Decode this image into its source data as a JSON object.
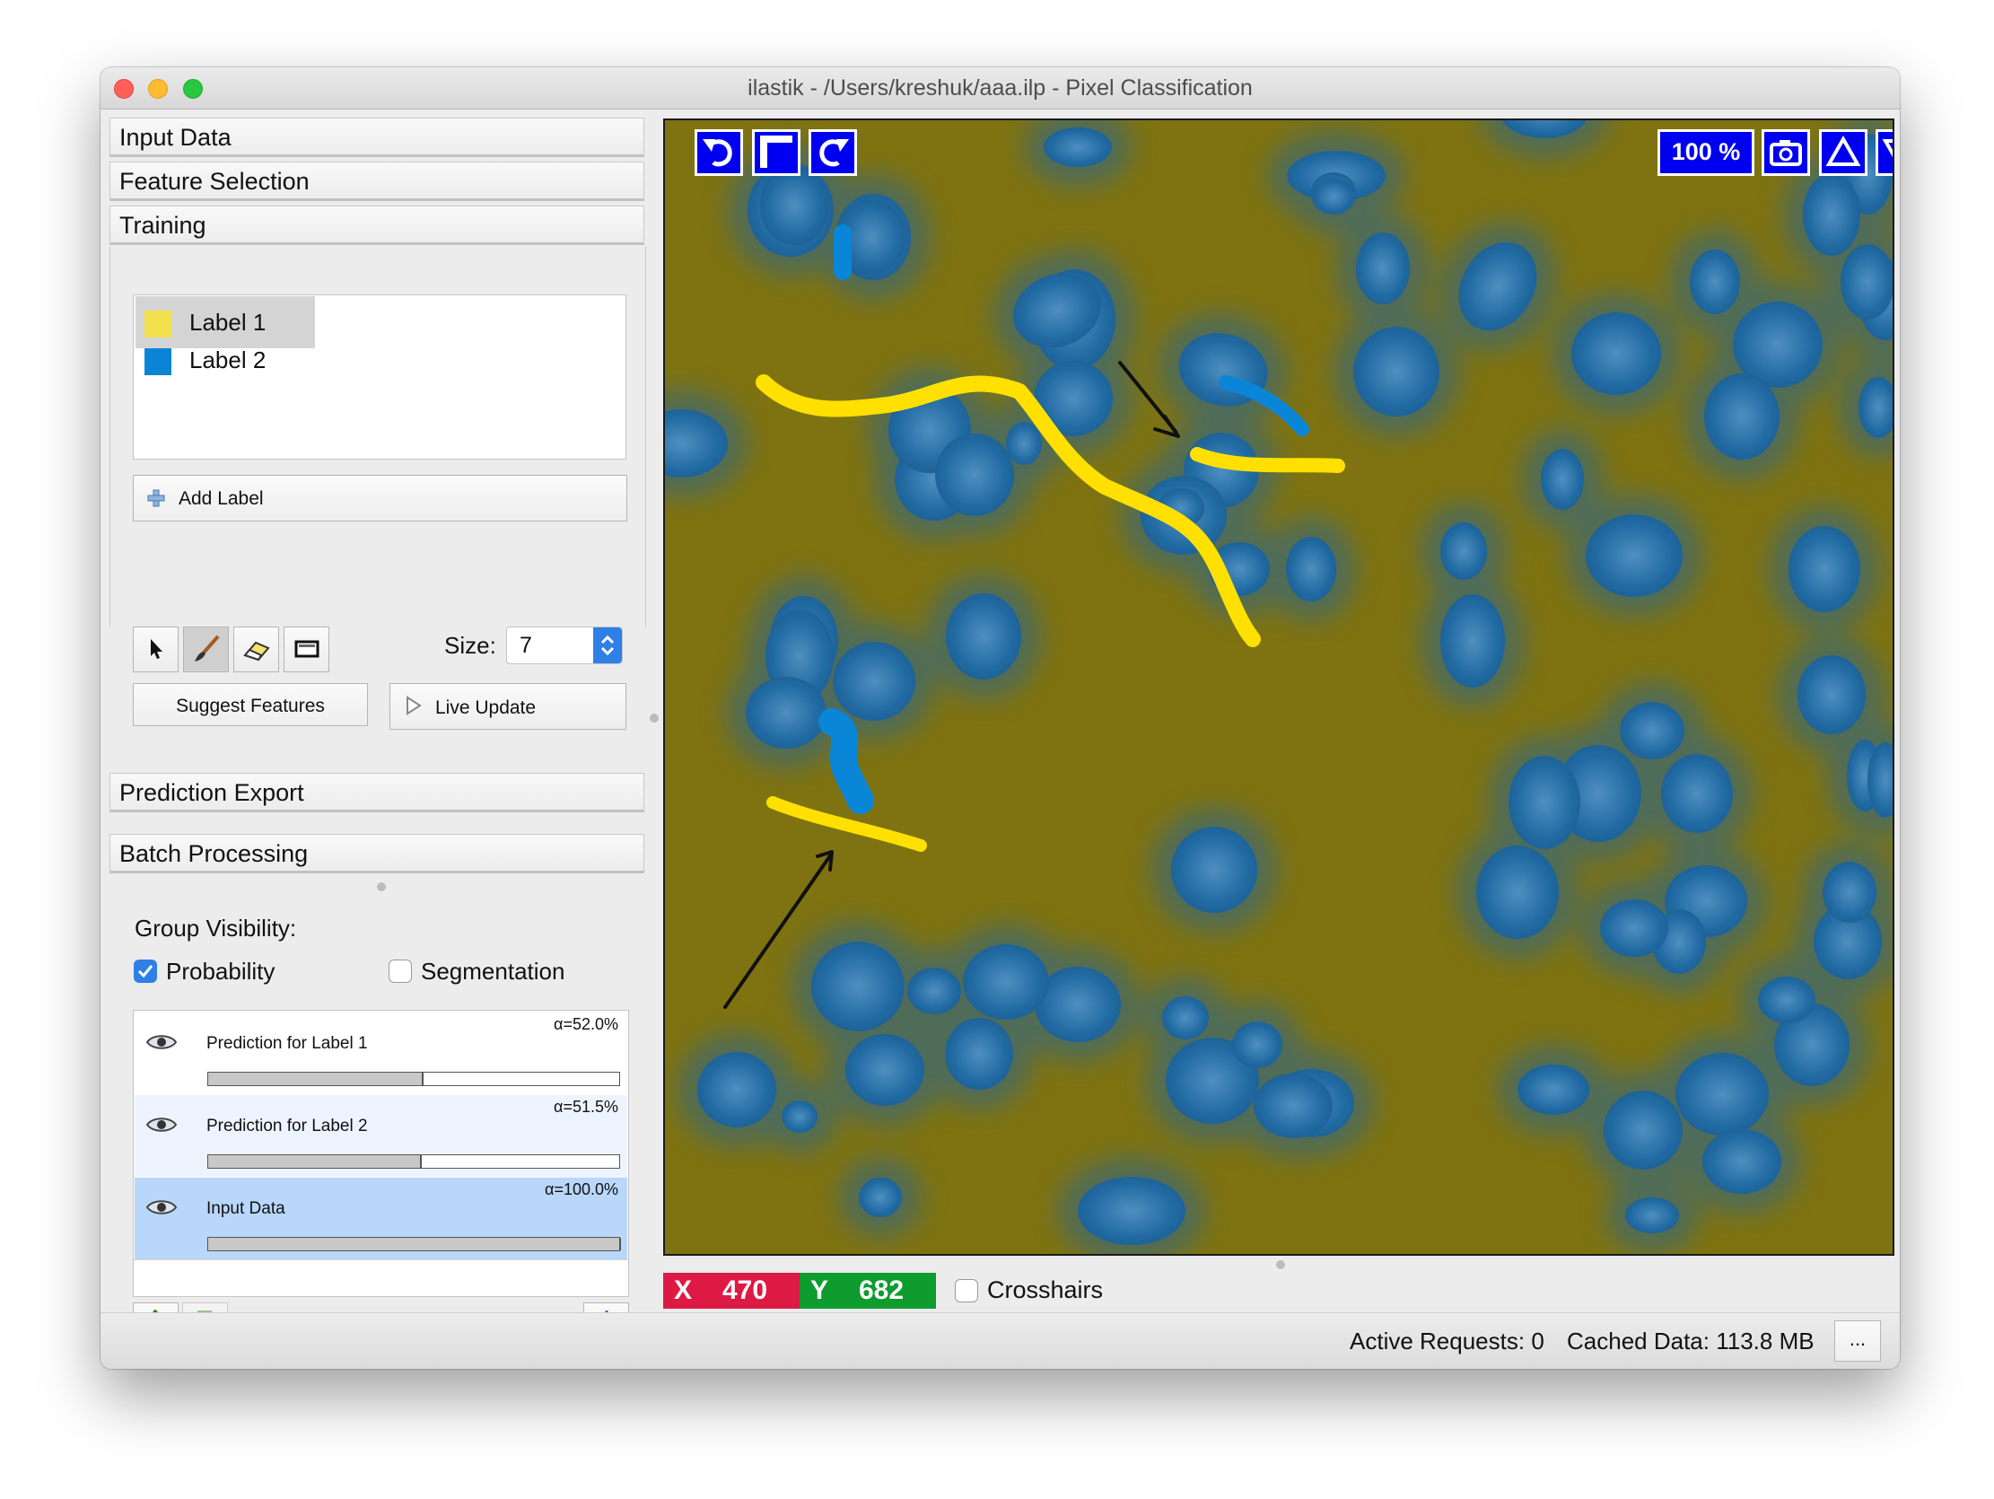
{
  "window": {
    "title": "ilastik - /Users/kreshuk/aaa.ilp - Pixel Classification"
  },
  "applets": {
    "input_data": "Input Data",
    "feature_selection": "Feature Selection",
    "training": "Training",
    "prediction_export": "Prediction Export",
    "batch_processing": "Batch Processing"
  },
  "labels": [
    {
      "name": "Label 1",
      "color": "#f2e04d"
    },
    {
      "name": "Label 2",
      "color": "#0b84d6"
    }
  ],
  "training": {
    "add_label": "Add Label",
    "size_label": "Size:",
    "size_value": "7",
    "suggest_features": "Suggest Features",
    "live_update": "Live Update"
  },
  "visibility": {
    "group_label": "Group Visibility:",
    "probability": "Probability",
    "probability_checked": true,
    "segmentation": "Segmentation",
    "segmentation_checked": false
  },
  "layers": [
    {
      "name": "Prediction for Label 1",
      "alpha": "α=52.0%",
      "opacity": 0.52,
      "selected": false
    },
    {
      "name": "Prediction for Label 2",
      "alpha": "α=51.5%",
      "opacity": 0.515,
      "selected": false
    },
    {
      "name": "Input Data",
      "alpha": "α=100.0%",
      "opacity": 1.0,
      "selected": true
    }
  ],
  "viewer": {
    "zoom": "100 %",
    "x_label": "X",
    "x_value": "470",
    "y_label": "Y",
    "y_value": "682",
    "crosshairs": "Crosshairs",
    "background_color": "#7f7311",
    "nucleus_color": "#1e6aa0",
    "label1_stroke_color": "#ffe000",
    "label2_stroke_color": "#0a86d8"
  },
  "status": {
    "active_requests": "Active Requests: 0",
    "cached_data": "Cached Data: 113.8 MB",
    "more_button": "..."
  }
}
